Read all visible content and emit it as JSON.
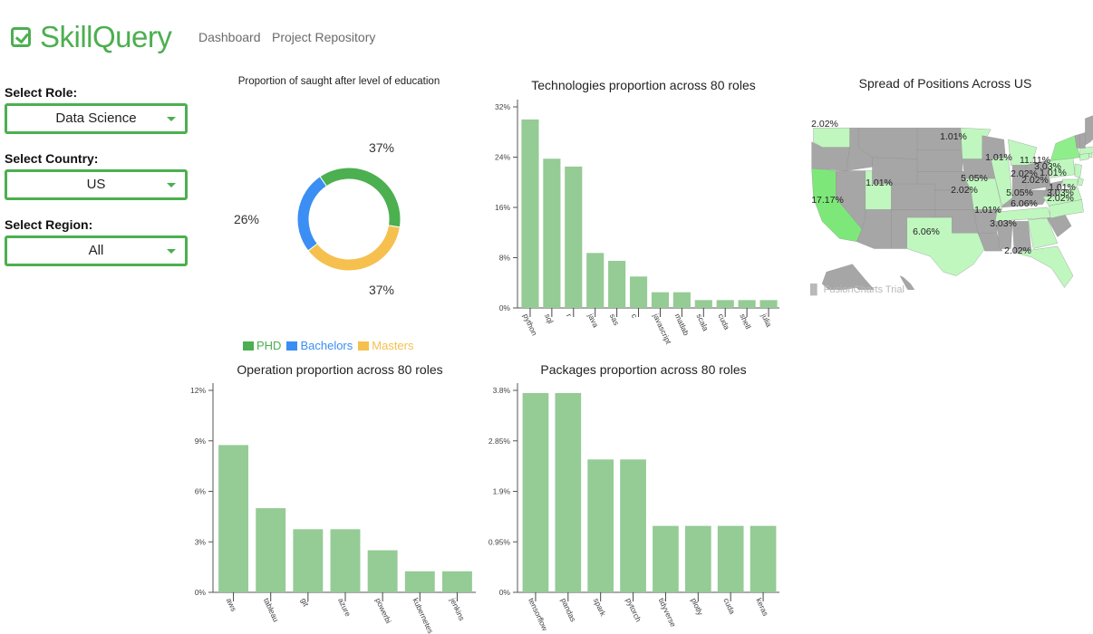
{
  "app": {
    "name": "SkillQuery",
    "logo_icon": "checkbox-checked-icon",
    "brand_color": "#4caf50"
  },
  "nav": {
    "items": [
      {
        "label": "Dashboard"
      },
      {
        "label": "Project Repository"
      }
    ]
  },
  "filters": {
    "role": {
      "label": "Select Role:",
      "value": "Data Science"
    },
    "country": {
      "label": "Select Country:",
      "value": "US"
    },
    "region": {
      "label": "Select Region:",
      "value": "All"
    }
  },
  "chart_data": [
    {
      "id": "education",
      "type": "pie",
      "donut": true,
      "title": "Proportion of saught after level of education",
      "categories": [
        "PHD",
        "Bachelors",
        "Masters"
      ],
      "values": [
        37,
        26,
        37
      ],
      "labels": [
        "37%",
        "26%",
        "37%"
      ],
      "colors": [
        "#4caf50",
        "#3b8ef3",
        "#f6c04f"
      ],
      "legend": "bottom"
    },
    {
      "id": "technologies",
      "type": "bar",
      "title": "Technologies proportion across 80 roles",
      "categories": [
        "python",
        "sql",
        "r",
        "java",
        "sas",
        "c",
        "javascript",
        "matlab",
        "scala",
        "cuda",
        "shell",
        "julia"
      ],
      "values": [
        30,
        23.75,
        22.5,
        8.75,
        7.5,
        5,
        2.5,
        2.5,
        1.25,
        1.25,
        1.25,
        1.25
      ],
      "yticks": [
        "0%",
        "8%",
        "16%",
        "24%",
        "32%"
      ],
      "ytick_values": [
        0,
        8,
        16,
        24,
        32
      ],
      "ylim": [
        0,
        32
      ],
      "color": "#95cb95",
      "xlabel": "",
      "ylabel": ""
    },
    {
      "id": "operations",
      "type": "bar",
      "title": "Operation proportion across 80 roles",
      "categories": [
        "aws",
        "tableau",
        "git",
        "azure",
        "powerbi",
        "kubernetes",
        "jenkins"
      ],
      "values": [
        8.75,
        5,
        3.75,
        3.75,
        2.5,
        1.25,
        1.25
      ],
      "yticks": [
        "0%",
        "3%",
        "6%",
        "9%",
        "12%"
      ],
      "ytick_values": [
        0,
        3,
        6,
        9,
        12
      ],
      "ylim": [
        0,
        12
      ],
      "color": "#95cb95",
      "xlabel": "",
      "ylabel": ""
    },
    {
      "id": "packages",
      "type": "bar",
      "title": "Packages proportion across 80 roles",
      "categories": [
        "tensorflow",
        "pandas",
        "spark",
        "pytorch",
        "tidyverse",
        "plotly",
        "cuda",
        "keras"
      ],
      "values": [
        3.75,
        3.75,
        2.5,
        2.5,
        1.25,
        1.25,
        1.25,
        1.25
      ],
      "yticks": [
        "0%",
        "0.95%",
        "1.9%",
        "2.85%",
        "3.8%"
      ],
      "ytick_values": [
        0,
        0.95,
        1.9,
        2.85,
        3.8
      ],
      "ylim": [
        0,
        3.8
      ],
      "color": "#95cb95",
      "xlabel": "",
      "ylabel": ""
    },
    {
      "id": "us-map",
      "type": "heatmap",
      "title": "Spread of Positions Across US",
      "watermark": "FusionCharts Trial",
      "colors": {
        "none": "#a6a6a6",
        "low": "#c0f7bf",
        "mid": "#8eef8a",
        "high": "#7de879"
      },
      "regions": [
        {
          "state": "WA",
          "value": "2.02%"
        },
        {
          "state": "CA",
          "value": "17.17%"
        },
        {
          "state": "UT",
          "value": "1.01%"
        },
        {
          "state": "TX",
          "value": "6.06%"
        },
        {
          "state": "MN",
          "value": "1.01%"
        },
        {
          "state": "MI",
          "value": "1.01%"
        },
        {
          "state": "IL",
          "value": "5.05%"
        },
        {
          "state": "MO",
          "value": "2.02%"
        },
        {
          "state": "TN",
          "value": "1.01%"
        },
        {
          "state": "GA",
          "value": "3.03%"
        },
        {
          "state": "FL",
          "value": "2.02%"
        },
        {
          "state": "VA",
          "value": "5.05%"
        },
        {
          "state": "NC",
          "value": "6.06%"
        },
        {
          "state": "NY",
          "value": "11.11%"
        },
        {
          "state": "PA",
          "value": "2.02%"
        },
        {
          "state": "NJ",
          "value": "2.02%"
        },
        {
          "state": "CT",
          "value": "3.03%"
        },
        {
          "state": "MA",
          "value": "1.01%"
        },
        {
          "state": "RI",
          "value": "1.01%"
        },
        {
          "state": "DE",
          "value": "3.03%"
        },
        {
          "state": "MD",
          "value": "2.02%"
        }
      ]
    }
  ]
}
